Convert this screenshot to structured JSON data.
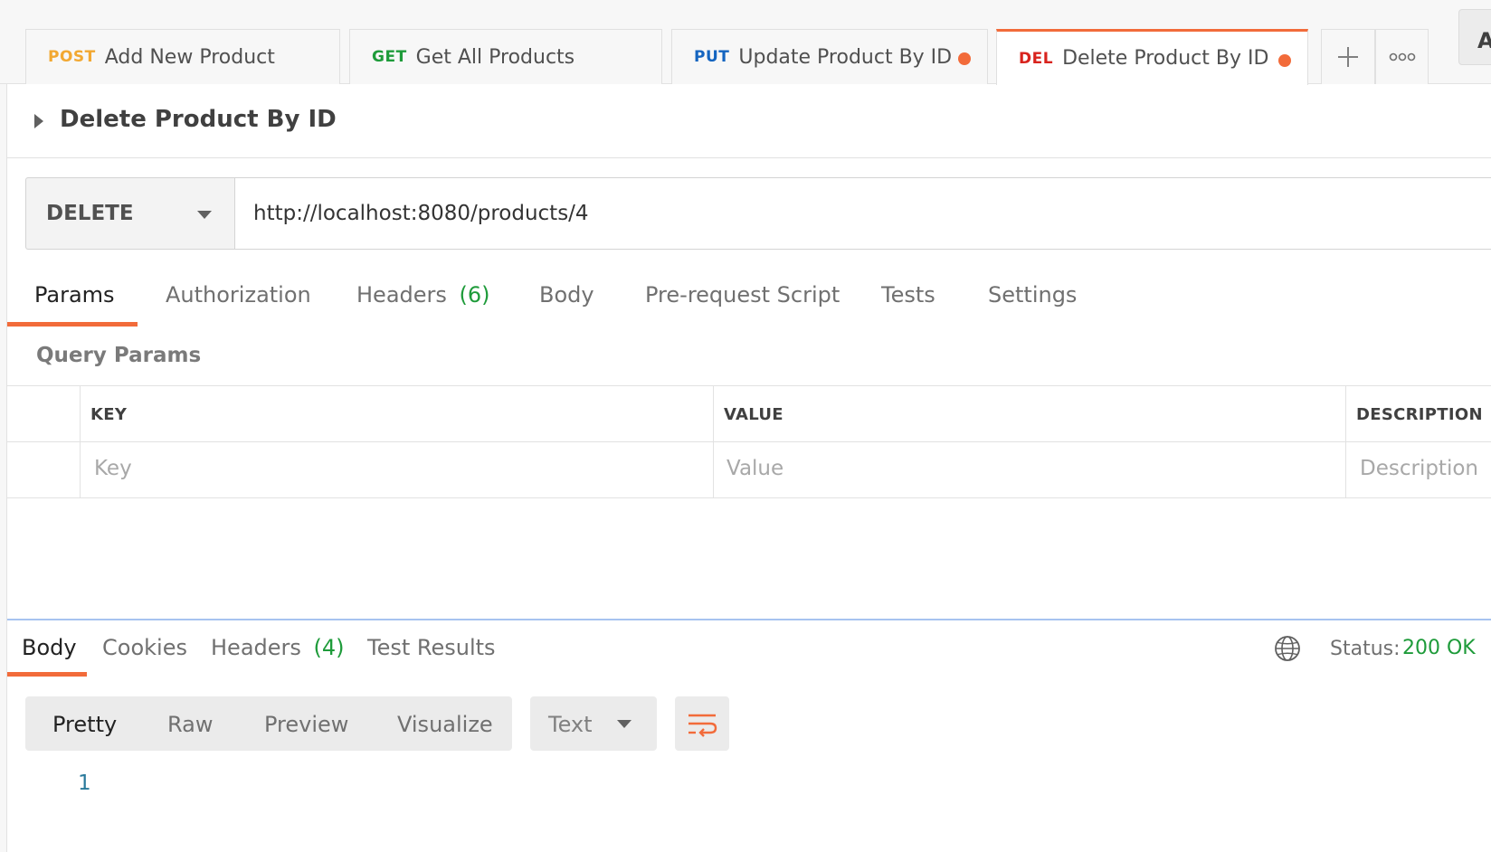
{
  "tabs": [
    {
      "method": "POST",
      "method_color": "#f2a832",
      "title": "Add New Product",
      "unsaved": false,
      "active": false
    },
    {
      "method": "GET",
      "method_color": "#1e9b3a",
      "title": "Get All Products",
      "unsaved": false,
      "active": false
    },
    {
      "method": "PUT",
      "method_color": "#1565c0",
      "title": "Update Product By ID",
      "unsaved": true,
      "active": false
    },
    {
      "method": "DEL",
      "method_color": "#d8231d",
      "title": "Delete Product By ID",
      "unsaved": true,
      "active": true
    }
  ],
  "corner_label": "A",
  "request": {
    "name": "Delete Product By ID",
    "method": "DELETE",
    "url": "http://localhost:8080/products/4"
  },
  "request_tabs": {
    "params": "Params",
    "authorization": "Authorization",
    "headers": "Headers",
    "headers_count": "(6)",
    "body": "Body",
    "prerequest": "Pre-request Script",
    "tests": "Tests",
    "settings": "Settings"
  },
  "query_params": {
    "title": "Query Params",
    "columns": {
      "key": "KEY",
      "value": "VALUE",
      "description": "DESCRIPTION"
    },
    "placeholders": {
      "key": "Key",
      "value": "Value",
      "description": "Description"
    }
  },
  "response": {
    "tabs": {
      "body": "Body",
      "cookies": "Cookies",
      "headers": "Headers",
      "headers_count": "(4)",
      "test_results": "Test Results"
    },
    "status_label": "Status:",
    "status_value": "200 OK",
    "views": {
      "pretty": "Pretty",
      "raw": "Raw",
      "preview": "Preview",
      "visualize": "Visualize"
    },
    "format": "Text",
    "line_number": "1"
  },
  "colors": {
    "accent": "#f26b3a",
    "success": "#1e9b3a"
  }
}
